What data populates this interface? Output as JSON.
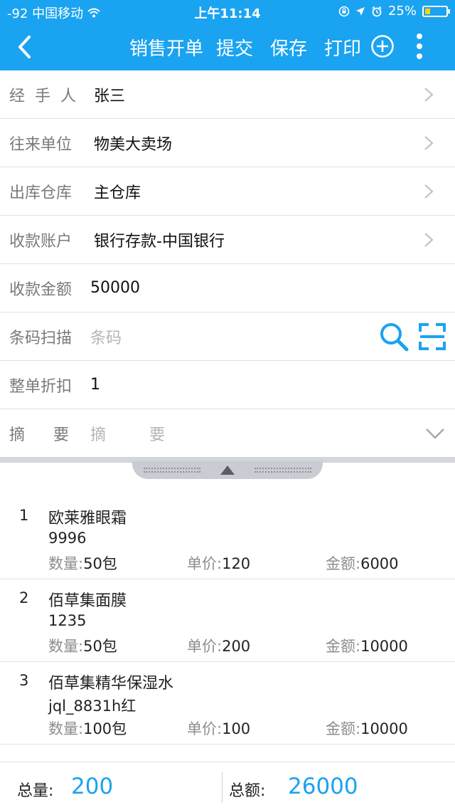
{
  "status_bar": {
    "carrier": "-92 中国移动",
    "time": "上午11:14",
    "battery": "25%",
    "battery_level": 0.25
  },
  "nav": {
    "title": "销售开单",
    "actions": [
      "提交",
      "保存",
      "打印"
    ]
  },
  "form": {
    "handler": {
      "label": "经手人",
      "value": "张三"
    },
    "partner": {
      "label": "往来单位",
      "value": "物美大卖场"
    },
    "warehouse": {
      "label": "出库仓库",
      "value": "主仓库"
    },
    "account": {
      "label": "收款账户",
      "value": "银行存款-中国银行"
    },
    "amount": {
      "label": "收款金额",
      "value": "50000"
    },
    "barcode": {
      "label": "条码扫描",
      "placeholder": "条码"
    },
    "discount": {
      "label": "整单折扣",
      "value": "1"
    },
    "summary": {
      "label": "摘要",
      "placeholder": "摘   要"
    }
  },
  "items": [
    {
      "num": "1",
      "name": "欧莱雅眼霜",
      "code": "9996",
      "qty_label": "数量:",
      "qty": "50包",
      "price_label": "单价:",
      "price": "120",
      "amount_label": "金额:",
      "amount": "6000"
    },
    {
      "num": "2",
      "name": "佰草集面膜",
      "code": "1235",
      "qty_label": "数量:",
      "qty": "50包",
      "price_label": "单价:",
      "price": "200",
      "amount_label": "金额:",
      "amount": "10000"
    },
    {
      "num": "3",
      "name": "佰草集精华保湿水",
      "code": "jql_8831h红",
      "qty_label": "数量:",
      "qty": "100包",
      "price_label": "单价:",
      "price": "100",
      "amount_label": "金额:",
      "amount": "10000"
    }
  ],
  "footer": {
    "total_qty_label": "总量:",
    "total_qty": "200",
    "total_amount_label": "总额:",
    "total_amount": "26000"
  },
  "colors": {
    "accent": "#1aa3f0",
    "battery": "#ffd400"
  },
  "icons": [
    "back-arrow-icon",
    "add-circle-icon",
    "more-vertical-icon",
    "chevron-right-icon",
    "search-icon",
    "scan-barcode-icon",
    "chevron-down-icon",
    "caret-up-icon",
    "wifi-icon",
    "location-icon",
    "alarm-icon",
    "lock-rotation-icon"
  ]
}
